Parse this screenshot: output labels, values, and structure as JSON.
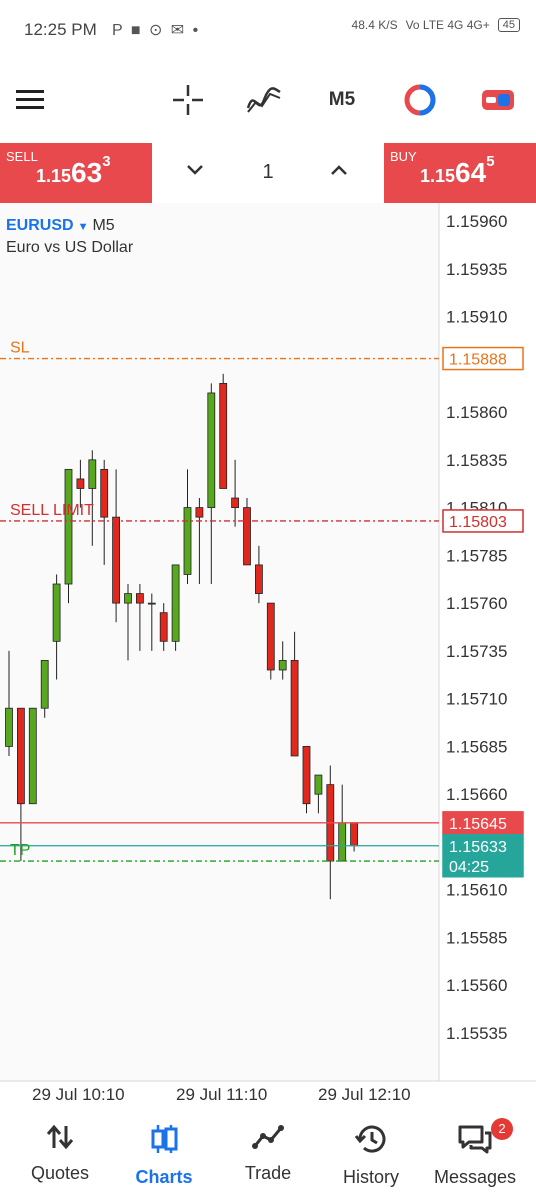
{
  "status_bar": {
    "time": "12:25 PM",
    "icons_text": "P ■ ⊙ ✉ •",
    "speed": "48.4 K/S",
    "network": "Vo LTE  4G  4G+",
    "battery": "45"
  },
  "toolbar": {
    "timeframe": "M5",
    "menu_icon": "hamburger-menu-icon",
    "crosshair_icon": "crosshair-icon",
    "indicator_icon": "indicator-icon",
    "objects_icon": "objects-icon",
    "trade_icon": "one-click-trade-icon"
  },
  "trade_panel": {
    "sell_label": "SELL",
    "sell_price_prefix": "1.15",
    "sell_price_big": "63",
    "sell_price_sup": "3",
    "buy_label": "BUY",
    "buy_price_prefix": "1.15",
    "buy_price_big": "64",
    "buy_price_sup": "5",
    "lot": "1"
  },
  "chart_header": {
    "symbol": "EURUSD",
    "timeframe": "M5",
    "description": "Euro vs US Dollar"
  },
  "chart_data": {
    "type": "candlestick",
    "price_axis": [
      "1.15960",
      "1.15935",
      "1.15910",
      "1.15860",
      "1.15835",
      "1.15810",
      "1.15785",
      "1.15760",
      "1.15735",
      "1.15710",
      "1.15685",
      "1.15660",
      "1.15610",
      "1.15585",
      "1.15560",
      "1.15535"
    ],
    "time_axis": [
      "29 Jul 10:10",
      "29 Jul 11:10",
      "29 Jul 12:10"
    ],
    "ylim": [
      1.15535,
      1.1596
    ],
    "levels": [
      {
        "label": "SL",
        "price": 1.15888,
        "tag": "1.15888",
        "color": "#e8741a"
      },
      {
        "label": "SELL LIMIT",
        "price": 1.15803,
        "tag": "1.15803",
        "color": "#d32f2f"
      },
      {
        "label": "",
        "price": 1.15645,
        "tag": "1.15645",
        "color": "#e8494c"
      },
      {
        "label": "",
        "price": 1.15633,
        "tag": "1.15633",
        "color": "#26a69a"
      },
      {
        "label": "TP",
        "price": 1.15625,
        "tag": "",
        "color": "#1ea31e"
      }
    ],
    "countdown": "04:25",
    "candles": [
      {
        "o": 1.15685,
        "h": 1.15735,
        "l": 1.1568,
        "c": 1.15705
      },
      {
        "o": 1.15705,
        "h": 1.15705,
        "l": 1.15625,
        "c": 1.15655
      },
      {
        "o": 1.15655,
        "h": 1.15705,
        "l": 1.15655,
        "c": 1.15705
      },
      {
        "o": 1.15705,
        "h": 1.1573,
        "l": 1.157,
        "c": 1.1573
      },
      {
        "o": 1.1574,
        "h": 1.15775,
        "l": 1.1572,
        "c": 1.1577
      },
      {
        "o": 1.1577,
        "h": 1.1583,
        "l": 1.1576,
        "c": 1.1583
      },
      {
        "o": 1.15825,
        "h": 1.15835,
        "l": 1.1581,
        "c": 1.1582
      },
      {
        "o": 1.1582,
        "h": 1.1584,
        "l": 1.1579,
        "c": 1.15835
      },
      {
        "o": 1.1583,
        "h": 1.15835,
        "l": 1.1578,
        "c": 1.15805
      },
      {
        "o": 1.15805,
        "h": 1.1583,
        "l": 1.1575,
        "c": 1.1576
      },
      {
        "o": 1.1576,
        "h": 1.1577,
        "l": 1.1573,
        "c": 1.15765
      },
      {
        "o": 1.15765,
        "h": 1.1577,
        "l": 1.15735,
        "c": 1.1576
      },
      {
        "o": 1.1576,
        "h": 1.15765,
        "l": 1.15735,
        "c": 1.1576
      },
      {
        "o": 1.15755,
        "h": 1.1576,
        "l": 1.15735,
        "c": 1.1574
      },
      {
        "o": 1.1574,
        "h": 1.1578,
        "l": 1.15735,
        "c": 1.1578
      },
      {
        "o": 1.15775,
        "h": 1.1583,
        "l": 1.1577,
        "c": 1.1581
      },
      {
        "o": 1.1581,
        "h": 1.15815,
        "l": 1.1577,
        "c": 1.15805
      },
      {
        "o": 1.1581,
        "h": 1.15875,
        "l": 1.1577,
        "c": 1.1587
      },
      {
        "o": 1.15875,
        "h": 1.1588,
        "l": 1.1582,
        "c": 1.1582
      },
      {
        "o": 1.15815,
        "h": 1.15835,
        "l": 1.158,
        "c": 1.1581
      },
      {
        "o": 1.1581,
        "h": 1.15815,
        "l": 1.1578,
        "c": 1.1578
      },
      {
        "o": 1.1578,
        "h": 1.1579,
        "l": 1.1576,
        "c": 1.15765
      },
      {
        "o": 1.1576,
        "h": 1.1576,
        "l": 1.1572,
        "c": 1.15725
      },
      {
        "o": 1.15725,
        "h": 1.1574,
        "l": 1.1572,
        "c": 1.1573
      },
      {
        "o": 1.1573,
        "h": 1.15745,
        "l": 1.1568,
        "c": 1.1568
      },
      {
        "o": 1.15685,
        "h": 1.15685,
        "l": 1.1565,
        "c": 1.15655
      },
      {
        "o": 1.1566,
        "h": 1.1567,
        "l": 1.1565,
        "c": 1.1567
      },
      {
        "o": 1.15665,
        "h": 1.15675,
        "l": 1.15605,
        "c": 1.15625
      },
      {
        "o": 1.15625,
        "h": 1.15665,
        "l": 1.15625,
        "c": 1.15645
      },
      {
        "o": 1.15645,
        "h": 1.15645,
        "l": 1.1563,
        "c": 1.15633
      }
    ],
    "up_color": "#57a81e",
    "down_color": "#e0281f",
    "grid": false
  },
  "bottom_nav": {
    "items": [
      {
        "label": "Quotes",
        "icon": "quotes-icon"
      },
      {
        "label": "Charts",
        "icon": "charts-icon"
      },
      {
        "label": "Trade",
        "icon": "trade-icon"
      },
      {
        "label": "History",
        "icon": "history-icon"
      },
      {
        "label": "Messages",
        "icon": "messages-icon"
      }
    ],
    "messages_badge": "2"
  }
}
